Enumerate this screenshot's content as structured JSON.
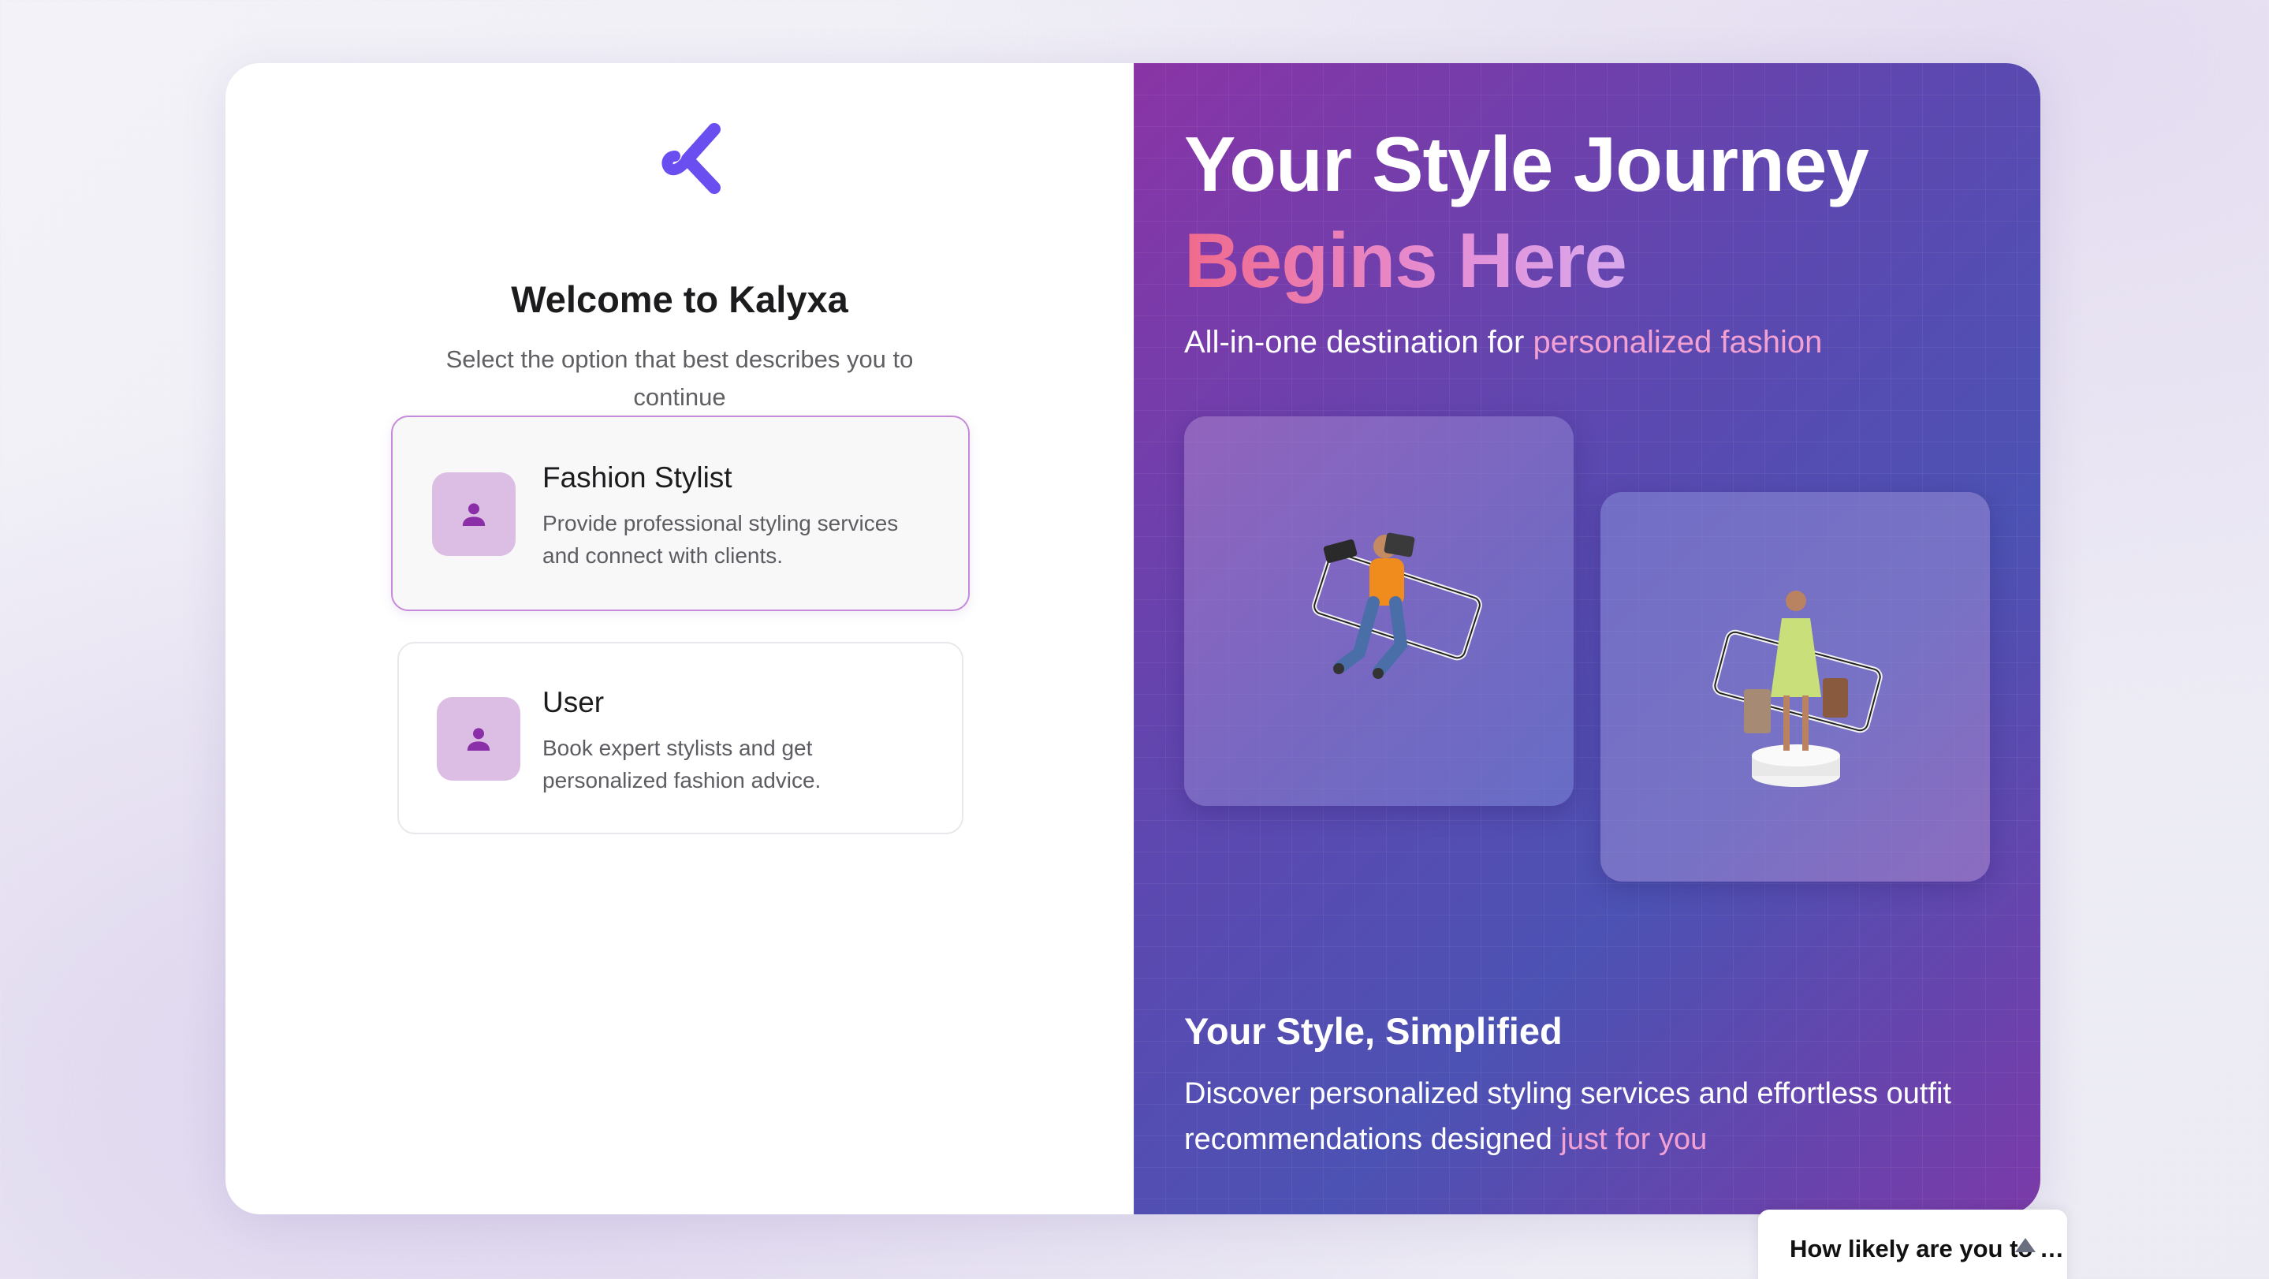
{
  "left": {
    "title": "Welcome to Kalyxa",
    "subtitle": "Select the option that best describes you to continue",
    "options": [
      {
        "title": "Fashion Stylist",
        "description": "Provide professional styling services and connect with clients.",
        "icon": "person-icon",
        "selected": true
      },
      {
        "title": "User",
        "description": "Book expert stylists and get personalized fashion advice.",
        "icon": "person-icon",
        "selected": false
      }
    ]
  },
  "right": {
    "hero_line1": "Your Style Journey",
    "hero_line2": "Begins Here",
    "tagline_prefix": "All-in-one destination for ",
    "tagline_accent": "personalized fashion",
    "bottom_title": "Your Style, Simplified",
    "bottom_desc_prefix": "Discover personalized styling services and effortless outfit recommendations designed ",
    "bottom_desc_accent": "just for you"
  },
  "survey": {
    "label": "How likely are you to recomme…"
  },
  "colors": {
    "brand": "#6a4ef0",
    "accent_pink": "#f3a0d3",
    "icon_bg": "#dcbde4",
    "icon_fg": "#8a2fa8"
  }
}
